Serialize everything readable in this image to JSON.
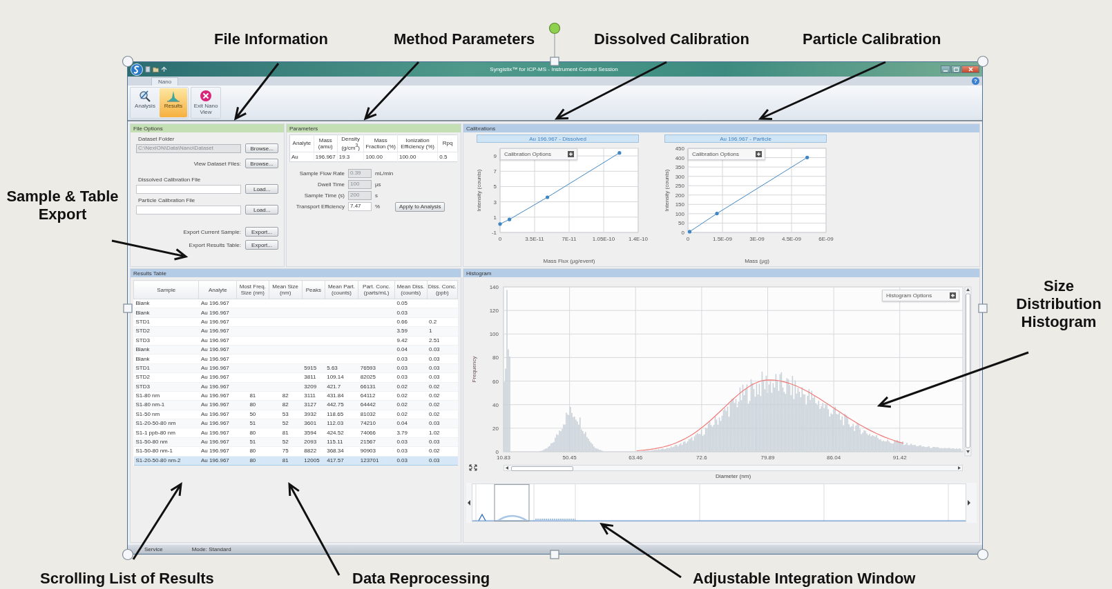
{
  "callouts": [
    {
      "text": "File Information"
    },
    {
      "text": "Method Parameters"
    },
    {
      "text": "Dissolved Calibration"
    },
    {
      "text": "Particle Calibration"
    },
    {
      "text": "Sample & Table Export"
    },
    {
      "text": "Size Distribution Histogram"
    },
    {
      "text": "Scrolling List of Results"
    },
    {
      "text": "Data Reprocessing"
    },
    {
      "text": "Adjustable Integration Window"
    }
  ],
  "window": {
    "title": "Syngistix™ for ICP-MS - Instrument Control Session",
    "tabs": [
      {
        "label": "Nano",
        "selected": true
      }
    ],
    "help": "?",
    "ribbon_buttons": [
      {
        "label": "Analysis",
        "kind": "analysis",
        "selected": false
      },
      {
        "label": "Results",
        "kind": "results",
        "selected": true
      },
      {
        "label": "Exit Nano View",
        "kind": "exit",
        "selected": false
      }
    ]
  },
  "file_options": {
    "title": "File Options",
    "items": [
      {
        "kind": "field",
        "label": "Dataset Folder",
        "value": "C:\\NexION\\Data\\Nano\\Dataset",
        "button": "Browse...",
        "disabled": true
      },
      {
        "kind": "inline",
        "label": "View Dataset Files:",
        "button": "Browse...",
        "disabled": false
      },
      {
        "kind": "field",
        "label": "Dissolved Calibration File",
        "button": "Load...",
        "disabled": false
      },
      {
        "kind": "field",
        "label": "Particle Calibration File",
        "button": "Load...",
        "disabled": false
      },
      {
        "kind": "inline",
        "label": "Export Current Sample:",
        "button": "Export...",
        "disabled": false
      },
      {
        "kind": "inline",
        "label": "Export Results Table:",
        "button": "Export...",
        "disabled": false
      }
    ]
  },
  "parameters": {
    "title": "Parameters",
    "columns": [
      "Analyte",
      "Mass (amu)",
      "Density (g/cm$^{3}$)",
      "Mass Fraction (%)",
      "Ionization Efficiency (%)",
      "Rpq"
    ],
    "rows": [
      [
        "Au",
        "196.967",
        "19.3",
        "100.00",
        "100.00",
        "0.5"
      ]
    ],
    "fields": [
      {
        "label": "Sample Flow Rate",
        "value": "0.39",
        "unit": "mL/min",
        "disabled": true
      },
      {
        "label": "Dwell Time",
        "value": "100",
        "unit": "µs",
        "disabled": true
      },
      {
        "label": "Sample Time (s)",
        "value": "200",
        "unit": "s",
        "disabled": true
      },
      {
        "label": "Transport Efficiency",
        "value": "7.47",
        "unit": "%",
        "disabled": false
      }
    ],
    "apply_button": "Apply to Analysis"
  },
  "calibrations": {
    "title": "Calibrations",
    "charts": [
      {
        "title": "Au 196.967 - Dissolved",
        "options_label": "Calibration Options",
        "chart_data": {
          "type": "line",
          "grid": true,
          "xlabel": "Mass Flux (µg/event)",
          "ylabel": "Intensity (counts)",
          "xlim": [
            0,
            1.4e-10
          ],
          "ylim": [
            -1,
            10
          ],
          "xticks": [
            {
              "value": 0,
              "label": "0"
            },
            {
              "value": 3.5e-11,
              "label": "3.5E-11"
            },
            {
              "value": 7e-11,
              "label": "7E-11"
            },
            {
              "value": 1.05e-10,
              "label": "1.05E-10"
            },
            {
              "value": 1.4e-10,
              "label": "1.4E-10"
            }
          ],
          "yticks": [
            {
              "value": -1,
              "label": "-1"
            },
            {
              "value": 1,
              "label": "1"
            },
            {
              "value": 3,
              "label": "3"
            },
            {
              "value": 5,
              "label": "5"
            },
            {
              "value": 7,
              "label": "7"
            },
            {
              "value": 9,
              "label": "9"
            }
          ],
          "x": [
            0,
            9.5e-12,
            4.8e-11,
            1.21e-10
          ],
          "series": [
            {
              "color": "#3f86c4",
              "values": [
                0.1,
                0.7,
                3.6,
                9.4
              ]
            }
          ]
        }
      },
      {
        "title": "Au 196.967 - Particle",
        "options_label": "Calibration Options",
        "chart_data": {
          "type": "line",
          "grid": true,
          "xlabel": "Mass (µg)",
          "ylabel": "Intensity (counts)",
          "xlim": [
            0,
            6e-09
          ],
          "ylim": [
            0,
            450
          ],
          "xticks": [
            {
              "value": 0,
              "label": "0"
            },
            {
              "value": 1.5e-09,
              "label": "1.5E-09"
            },
            {
              "value": 3e-09,
              "label": "3E-09"
            },
            {
              "value": 4.5e-09,
              "label": "4.5E-09"
            },
            {
              "value": 6e-09,
              "label": "6E-09"
            }
          ],
          "yticks": [
            {
              "value": 0,
              "label": "0"
            },
            {
              "value": 50,
              "label": "50"
            },
            {
              "value": 100,
              "label": "100"
            },
            {
              "value": 150,
              "label": "150"
            },
            {
              "value": 200,
              "label": "200"
            },
            {
              "value": 250,
              "label": "250"
            },
            {
              "value": 300,
              "label": "300"
            },
            {
              "value": 350,
              "label": "350"
            },
            {
              "value": 400,
              "label": "400"
            },
            {
              "value": 450,
              "label": "450"
            }
          ],
          "x": [
            7.5e-11,
            1.26e-09,
            5.18e-09
          ],
          "series": [
            {
              "color": "#3f86c4",
              "values": [
                4,
                101,
                401
              ]
            }
          ]
        }
      }
    ]
  },
  "results_table": {
    "title": "Results Table",
    "columns": [
      "Sample",
      "Analyte",
      "Most Freq. Size (nm)",
      "Mean Size (nm)",
      "Peaks",
      "Mean Part. (counts)",
      "Part. Conc. (parts/mL)",
      "Mean Diss. (counts)",
      "Diss. Conc. (ppb)"
    ],
    "rows": [
      {
        "selected": false,
        "sample": "Blank",
        "analyte": "Au 196.967",
        "mean_diss": "0.05"
      },
      {
        "selected": false,
        "sample": "Blank",
        "analyte": "Au 196.967",
        "mean_diss": "0.03"
      },
      {
        "selected": false,
        "sample": "STD1",
        "analyte": "Au 196.967",
        "mean_diss": "0.66",
        "diss_conc": "0.2"
      },
      {
        "selected": false,
        "sample": "STD2",
        "analyte": "Au 196.967",
        "mean_diss": "3.59",
        "diss_conc": "1"
      },
      {
        "selected": false,
        "sample": "STD3",
        "analyte": "Au 196.967",
        "mean_diss": "9.42",
        "diss_conc": "2.51"
      },
      {
        "selected": false,
        "sample": "Blank",
        "analyte": "Au 196.967",
        "mean_diss": "0.04",
        "diss_conc": "0.03"
      },
      {
        "selected": false,
        "sample": "Blank",
        "analyte": "Au 196.967",
        "mean_diss": "0.03",
        "diss_conc": "0.03"
      },
      {
        "selected": false,
        "sample": "STD1",
        "analyte": "Au 196.967",
        "peaks": "5915",
        "mean_part": "5.63",
        "part_conc": "76593",
        "mean_diss": "0.03",
        "diss_conc": "0.03"
      },
      {
        "selected": false,
        "sample": "STD2",
        "analyte": "Au 196.967",
        "peaks": "3811",
        "mean_part": "109.14",
        "part_conc": "82025",
        "mean_diss": "0.03",
        "diss_conc": "0.03"
      },
      {
        "selected": false,
        "sample": "STD3",
        "analyte": "Au 196.967",
        "peaks": "3209",
        "mean_part": "421.7",
        "part_conc": "66131",
        "mean_diss": "0.02",
        "diss_conc": "0.02"
      },
      {
        "selected": false,
        "sample": "S1-80 nm",
        "analyte": "Au 196.967",
        "most_freq_size": "81",
        "mean_size": "82",
        "peaks": "3111",
        "mean_part": "431.84",
        "part_conc": "64112",
        "mean_diss": "0.02",
        "diss_conc": "0.02"
      },
      {
        "selected": false,
        "sample": "S1-80 nm-1",
        "analyte": "Au 196.967",
        "most_freq_size": "80",
        "mean_size": "82",
        "peaks": "3127",
        "mean_part": "442.75",
        "part_conc": "64442",
        "mean_diss": "0.02",
        "diss_conc": "0.02"
      },
      {
        "selected": false,
        "sample": "S1-50 nm",
        "analyte": "Au 196.967",
        "most_freq_size": "50",
        "mean_size": "53",
        "peaks": "3932",
        "mean_part": "118.65",
        "part_conc": "81032",
        "mean_diss": "0.02",
        "diss_conc": "0.02"
      },
      {
        "selected": false,
        "sample": "S1-20-50-80 nm",
        "analyte": "Au 196.967",
        "most_freq_size": "51",
        "mean_size": "52",
        "peaks": "3601",
        "mean_part": "112.03",
        "part_conc": "74210",
        "mean_diss": "0.04",
        "diss_conc": "0.03"
      },
      {
        "selected": false,
        "sample": "S1-1 ppb-80 nm",
        "analyte": "Au 196.967",
        "most_freq_size": "80",
        "mean_size": "81",
        "peaks": "3594",
        "mean_part": "424.52",
        "part_conc": "74066",
        "mean_diss": "3.79",
        "diss_conc": "1.02"
      },
      {
        "selected": false,
        "sample": "S1-50-80 nm",
        "analyte": "Au 196.967",
        "most_freq_size": "51",
        "mean_size": "52",
        "peaks": "2093",
        "mean_part": "115.11",
        "part_conc": "21567",
        "mean_diss": "0.03",
        "diss_conc": "0.03"
      },
      {
        "selected": false,
        "sample": "S1-50-80 nm-1",
        "analyte": "Au 196.967",
        "most_freq_size": "80",
        "mean_size": "75",
        "peaks": "8822",
        "mean_part": "368.34",
        "part_conc": "90903",
        "mean_diss": "0.03",
        "diss_conc": "0.02"
      },
      {
        "selected": true,
        "sample": "S1-20-50-80 nm-2",
        "analyte": "Au 196.967",
        "most_freq_size": "80",
        "mean_size": "81",
        "peaks": "12005",
        "mean_part": "417.57",
        "part_conc": "123701",
        "mean_diss": "0.03",
        "diss_conc": "0.03"
      }
    ]
  },
  "histogram": {
    "title": "Histogram",
    "options_label": "Histogram Options",
    "ylabel": "Frequency",
    "xlabel": "Diameter (nm)",
    "yticks": [
      "140",
      "120",
      "100",
      "80",
      "60",
      "40",
      "20",
      "0"
    ],
    "xticks": [
      "10.83",
      "50.45",
      "63.46",
      "72.6",
      "79.89",
      "86.04",
      "91.42"
    ]
  },
  "status_bar": {
    "items": [
      "Service",
      "Mode: Standard"
    ]
  }
}
